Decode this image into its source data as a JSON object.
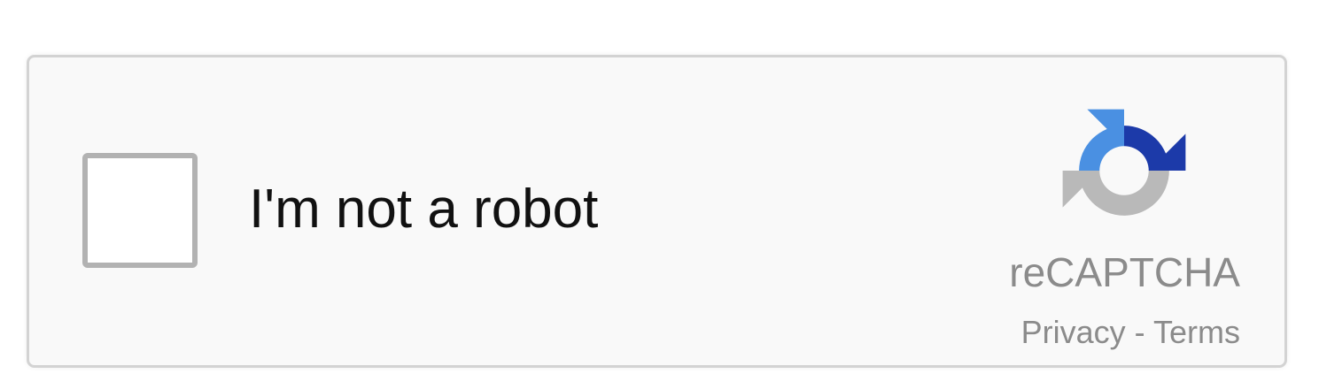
{
  "recaptcha": {
    "checkbox_label": "I'm not a robot",
    "checked": false,
    "brand": "reCAPTCHA",
    "privacy_link": "Privacy",
    "separator": " - ",
    "terms_link": "Terms",
    "logo_icon": "recaptcha-logo-icon"
  },
  "colors": {
    "widget_background": "#f9f9f9",
    "widget_border": "#d3d3d3",
    "checkbox_border": "#b2b2b2",
    "label_text": "#111111",
    "muted_text": "#8b8b8b",
    "logo_light_blue": "#4a90e2",
    "logo_dark_blue": "#1c3aa9",
    "logo_gray": "#b9b9b9"
  }
}
